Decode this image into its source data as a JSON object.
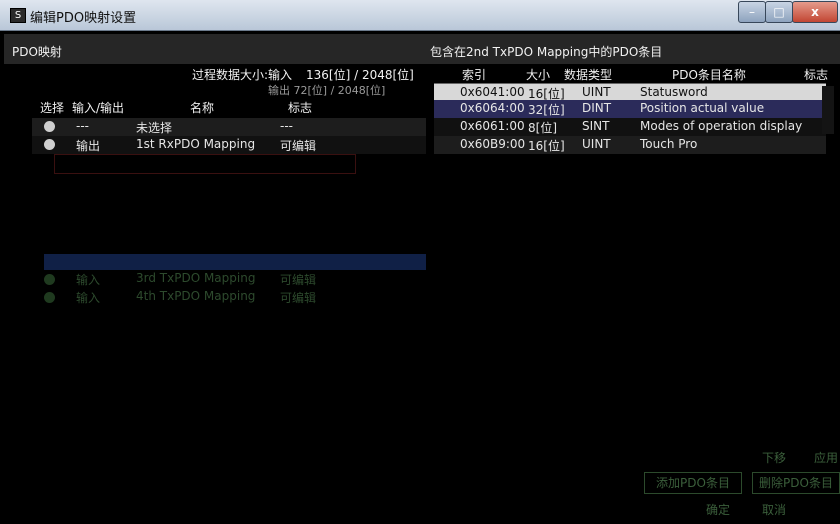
{
  "window": {
    "title": "编辑PDO映射设置",
    "buttons": {
      "minimize": "–",
      "maximize": "□",
      "close": "x"
    }
  },
  "left": {
    "section_label": "PDO映射",
    "size_label": "过程数据大小:输入",
    "input_size": "136[位] / 2048[位]",
    "overlap_text": "输出 72[位] / 2048[位]",
    "headers": {
      "select": "选择",
      "io": "输入/输出",
      "name": "名称",
      "flag": "标志"
    },
    "rows": [
      {
        "io": "---",
        "name": "未选择",
        "flag": "---"
      },
      {
        "io": "输出",
        "name": "1st RxPDO Mapping",
        "flag": "可编辑"
      }
    ],
    "faded_rows": [
      {
        "io": "输入",
        "name": "3rd TxPDO Mapping",
        "flag": "可编辑"
      },
      {
        "io": "输入",
        "name": "4th TxPDO Mapping",
        "flag": "可编辑"
      }
    ]
  },
  "right": {
    "section_label": "包含在2nd TxPDO Mapping中的PDO条目",
    "headers": {
      "index": "索引",
      "size": "大小",
      "type": "数据类型",
      "name": "PDO条目名称",
      "flag": "标志"
    },
    "rows": [
      {
        "index": "0x6041:00",
        "size": "16[位]",
        "type": "UINT",
        "name": "Statusword"
      },
      {
        "index": "0x6064:00",
        "size": "32[位]",
        "type": "DINT",
        "name": "Position actual value"
      },
      {
        "index": "0x6061:00",
        "size": "8[位]",
        "type": "SINT",
        "name": "Modes of operation display"
      },
      {
        "index": "0x60B9:00",
        "size": "16[位]",
        "type": "UINT",
        "name": "Touch Pro"
      }
    ]
  },
  "buttons": {
    "down": "下移",
    "add": "添加PDO条目",
    "delete": "删除PDO条目",
    "ok": "确定",
    "cancel": "取消",
    "apply": "应用"
  }
}
